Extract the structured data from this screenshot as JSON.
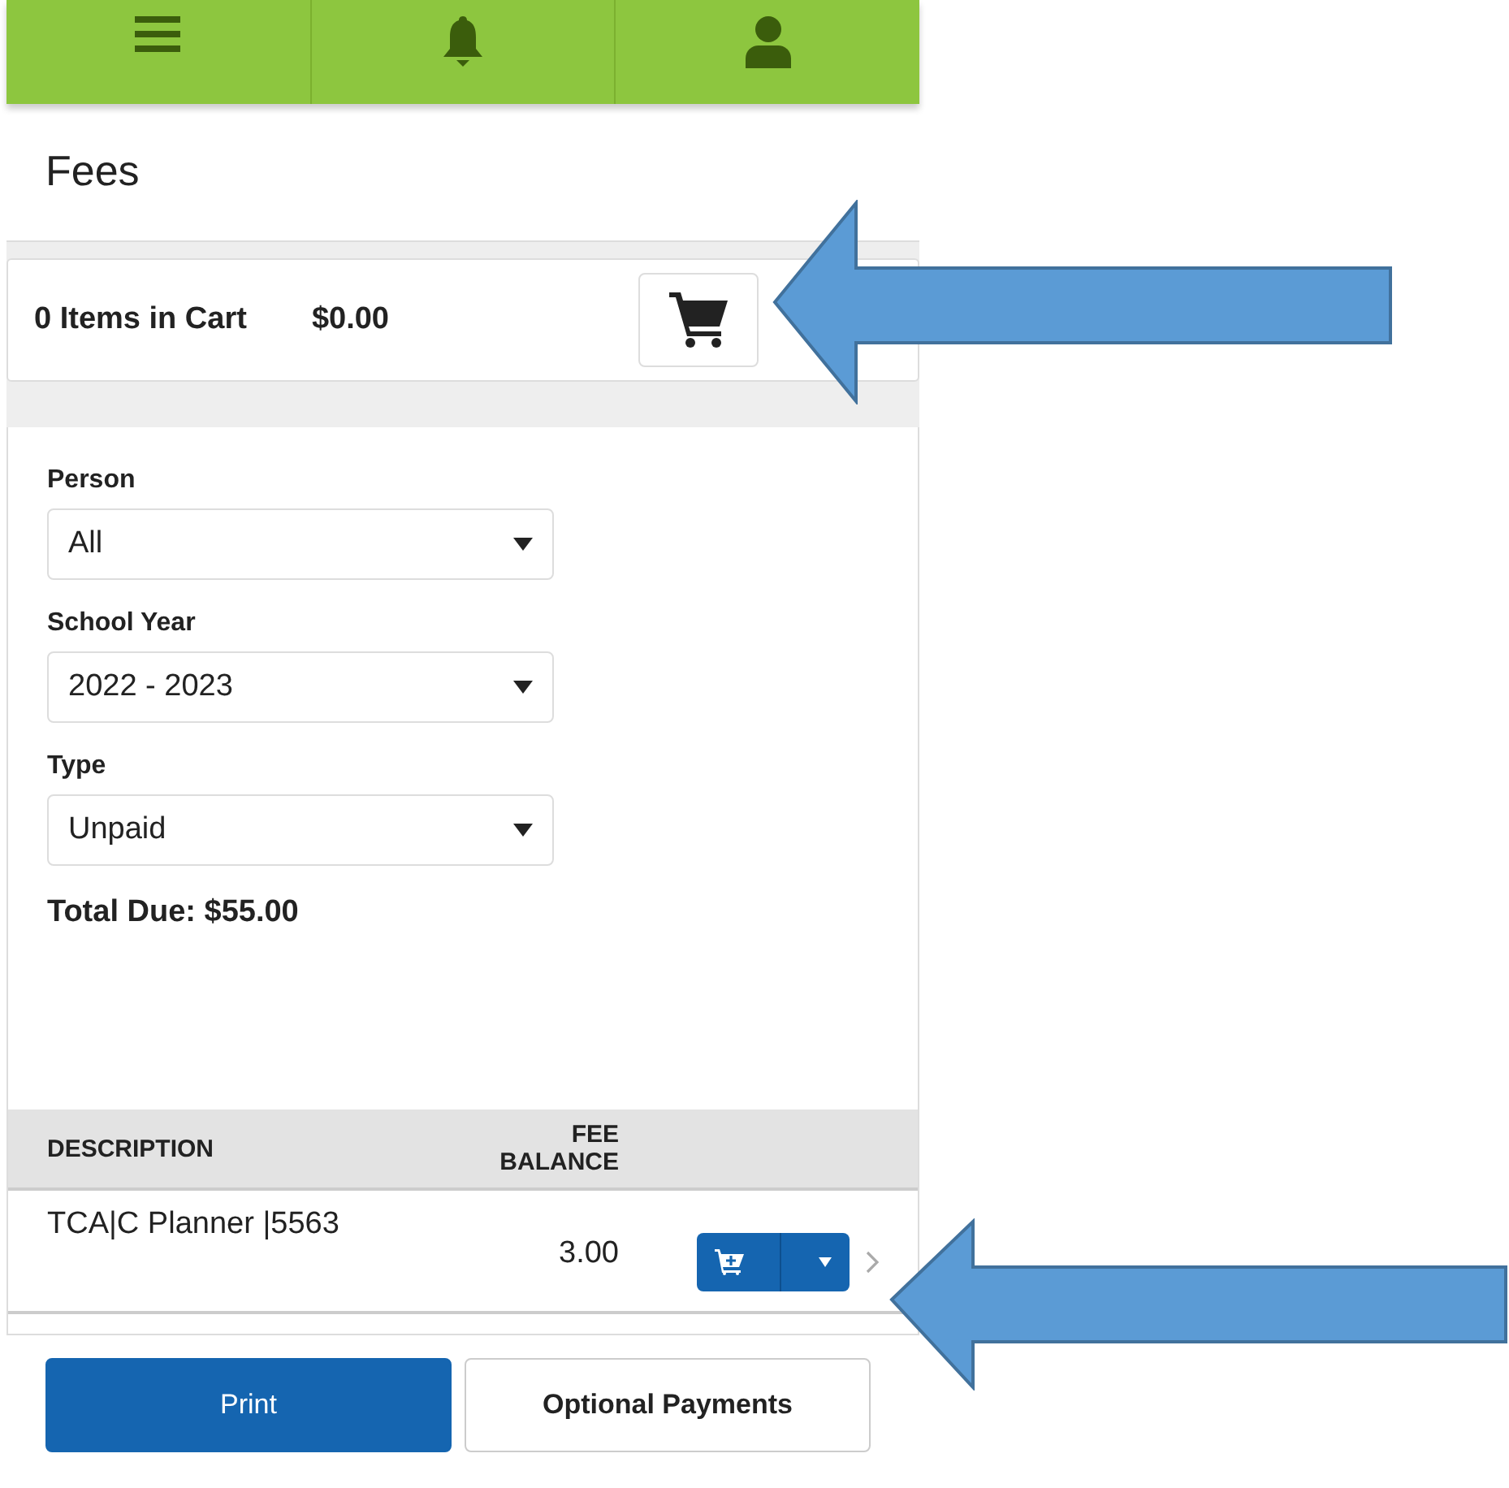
{
  "page_title": "Fees",
  "cart": {
    "summary": "0 Items in Cart",
    "total": "$0.00"
  },
  "filters": [
    {
      "label": "Person",
      "value": "All"
    },
    {
      "label": "School Year",
      "value": "2022 - 2023"
    },
    {
      "label": "Type",
      "value": "Unpaid"
    }
  ],
  "total_due": "Total Due: $55.00",
  "table": {
    "columns": [
      "DESCRIPTION",
      "FEE BALANCE"
    ],
    "rows": [
      {
        "description": "TCA|C Planner |5563",
        "balance": "3.00"
      }
    ]
  },
  "buttons": [
    {
      "label": "Print",
      "kind": "primary"
    },
    {
      "label": "Optional Payments",
      "kind": "secondary"
    }
  ]
}
